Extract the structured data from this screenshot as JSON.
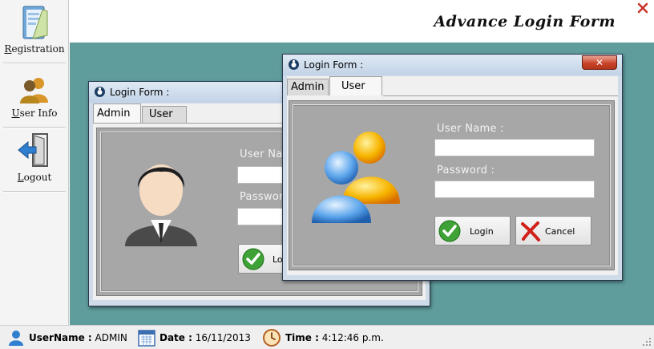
{
  "app": {
    "title": "Advance Login Form"
  },
  "sidebar": {
    "items": [
      {
        "label": "Registration",
        "icon": "registration-folder-icon"
      },
      {
        "label": "User Info",
        "icon": "users-icon"
      },
      {
        "label": "Logout",
        "icon": "logout-door-icon"
      }
    ]
  },
  "dialog_back": {
    "title": "Login Form :",
    "tabs": [
      "Admin",
      "User"
    ],
    "active_tab": "Admin",
    "username_label": "User Name :",
    "password_label": "Password :",
    "login_button": "Login",
    "username_value": "",
    "password_value": ""
  },
  "dialog_front": {
    "title": "Login Form :",
    "tabs": [
      "Admin",
      "User"
    ],
    "active_tab": "User",
    "username_label": "User Name :",
    "password_label": "Password :",
    "login_button": "Login",
    "cancel_button": "Cancel",
    "username_value": "",
    "password_value": ""
  },
  "status": {
    "username_label": "UserName :",
    "username_value": "ADMIN",
    "date_label": "Date :",
    "date_value": "16/11/2013",
    "time_label": "Time :",
    "time_value": "4:12:46 p.m."
  },
  "colors": {
    "workspace": "#5f9c9c",
    "panel": "#a7a7a7",
    "title_close": "#c9452b"
  }
}
